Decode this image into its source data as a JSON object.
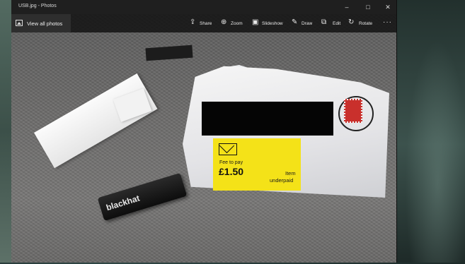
{
  "window": {
    "title": "USB.jpg - Photos",
    "controls": {
      "minimize": "–",
      "maximize": "□",
      "close": "✕"
    }
  },
  "toolbar": {
    "view_all_label": "View all photos",
    "view_all_icon": "image-icon",
    "items": [
      {
        "label": "Share",
        "icon": "share-icon",
        "glyph": "⇪"
      },
      {
        "label": "Zoom",
        "icon": "zoom-icon",
        "glyph": "⊕"
      },
      {
        "label": "Slideshow",
        "icon": "slideshow-icon",
        "glyph": "▣"
      },
      {
        "label": "Draw",
        "icon": "draw-icon",
        "glyph": "✎"
      },
      {
        "label": "Edit",
        "icon": "edit-icon",
        "glyph": "⧉"
      },
      {
        "label": "Rotate",
        "icon": "rotate-icon",
        "glyph": "↻"
      }
    ],
    "more_label": "···"
  },
  "photo": {
    "label_fee": "Fee to pay",
    "label_amount": "£1.50",
    "label_item": "Item",
    "label_underpaid": "underpaid",
    "usb_brand": "blackhat"
  }
}
